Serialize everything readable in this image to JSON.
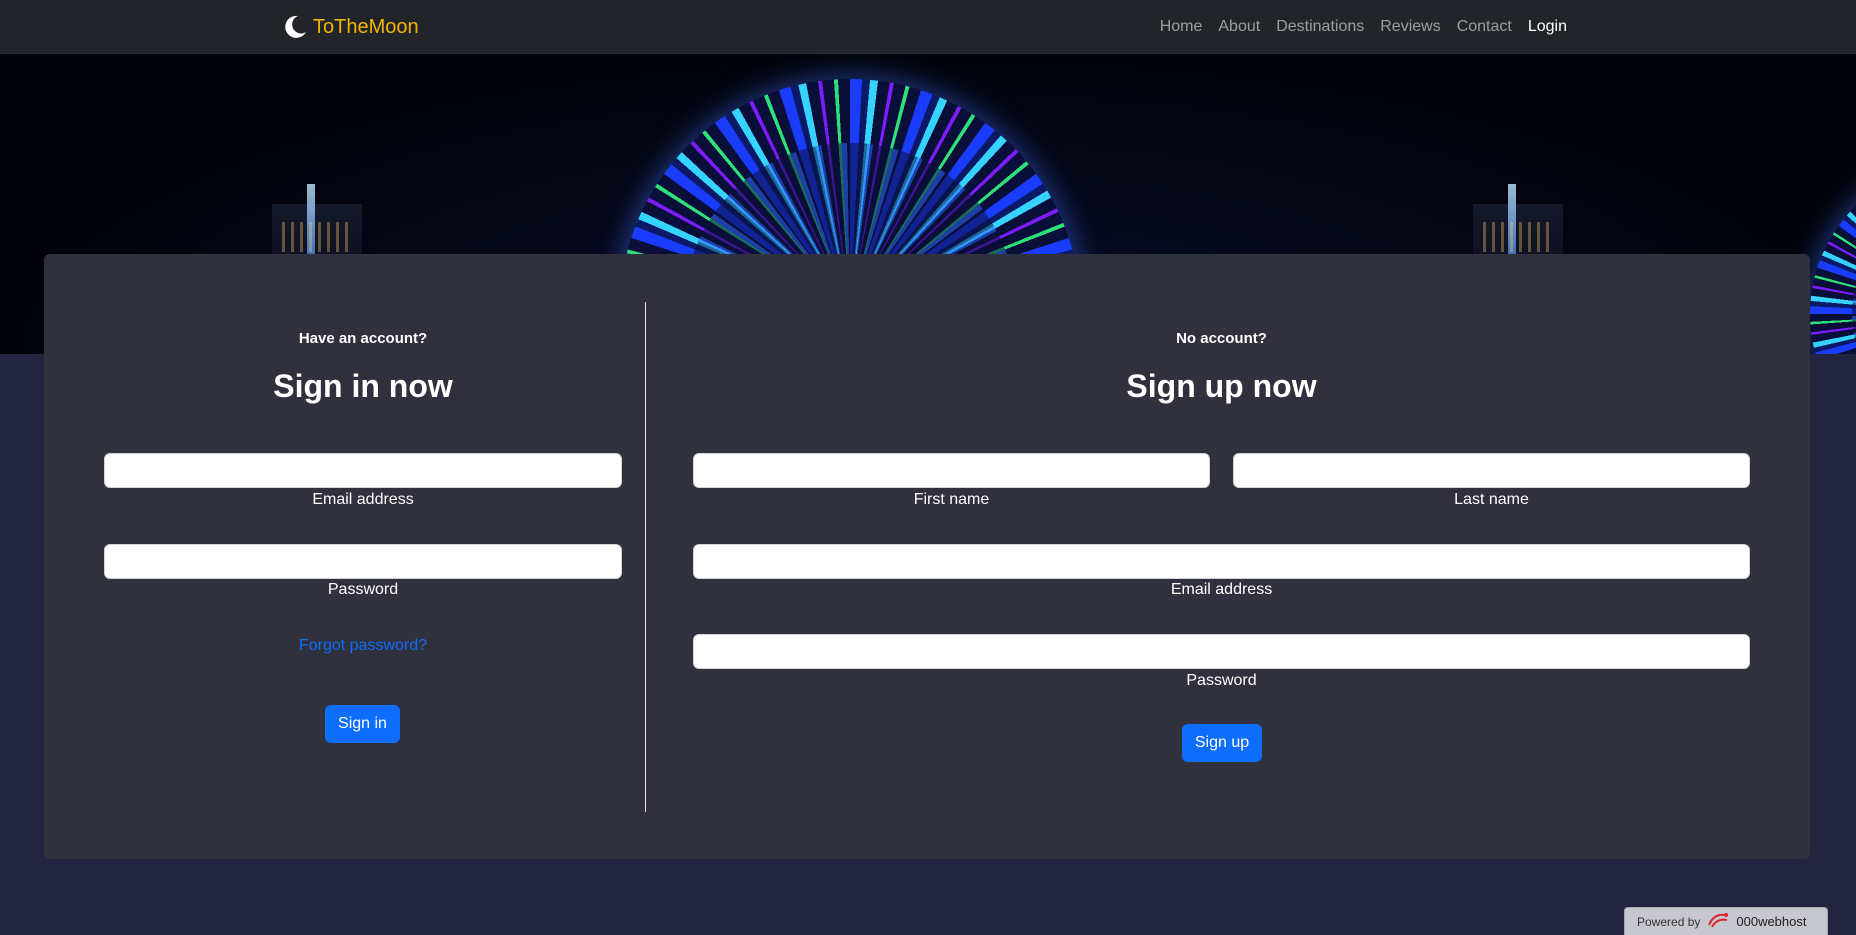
{
  "navbar": {
    "brand": "ToTheMoon",
    "brand_icon": "crescent-moon-icon",
    "links": [
      {
        "label": "Home",
        "active": false
      },
      {
        "label": "About",
        "active": false
      },
      {
        "label": "Destinations",
        "active": false
      },
      {
        "label": "Reviews",
        "active": false
      },
      {
        "label": "Contact",
        "active": false
      },
      {
        "label": "Login",
        "active": true
      }
    ]
  },
  "signin": {
    "subhead": "Have an account?",
    "heading": "Sign in now",
    "email_label": "Email address",
    "email_value": "",
    "password_label": "Password",
    "password_value": "",
    "forgot_link": "Forgot password?",
    "button": "Sign in"
  },
  "signup": {
    "subhead": "No account?",
    "heading": "Sign up now",
    "first_name_label": "First name",
    "first_name_value": "",
    "last_name_label": "Last name",
    "last_name_value": "",
    "email_label": "Email address",
    "email_value": "",
    "password_label": "Password",
    "password_value": "",
    "button": "Sign up"
  },
  "footer": {
    "powered_by": "Powered by",
    "host": "000webhost",
    "host_icon": "webhost-logo-icon"
  },
  "colors": {
    "brand": "#f5b400",
    "primary": "#0d6efd",
    "navbar_bg": "#212529",
    "card_bg": "#31303d",
    "page_bg": "#232540"
  }
}
